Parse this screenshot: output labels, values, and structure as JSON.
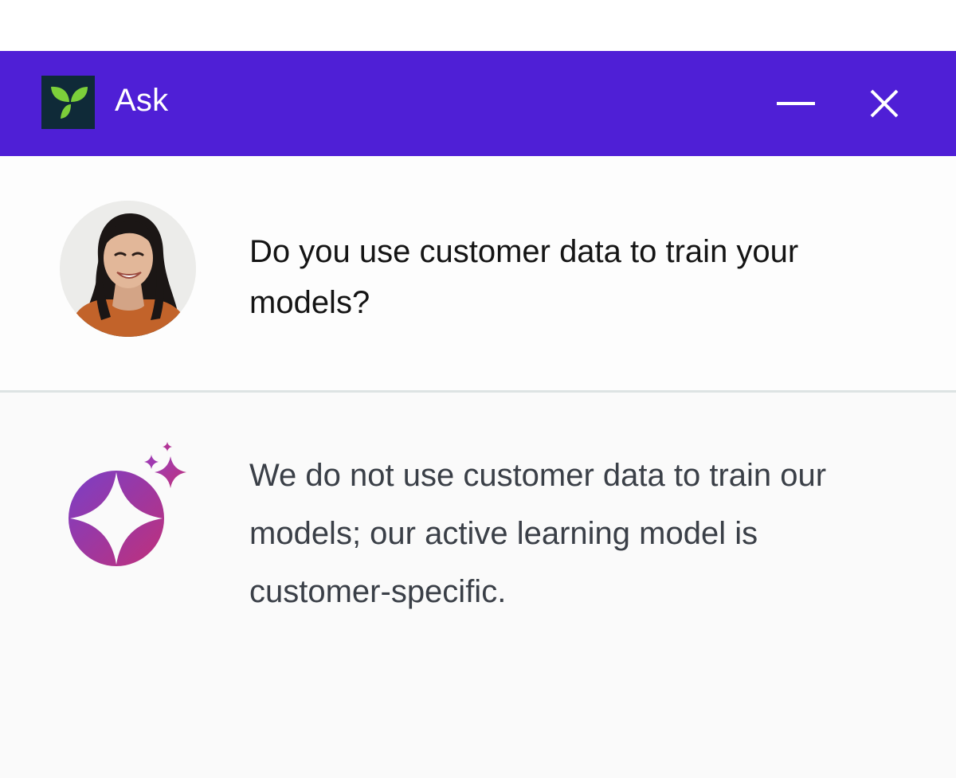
{
  "window": {
    "title": "Ask",
    "icons": {
      "logo": "leaf-logo-icon",
      "minimize": "minimize-icon",
      "close": "close-icon"
    }
  },
  "colors": {
    "header": "#4f1fd6",
    "logo_bg": "#0f2a38",
    "logo_leaf": "#7ccf3a",
    "ai_gradient_start": "#7a3fc7",
    "ai_gradient_end": "#c0307a"
  },
  "conversation": {
    "question": {
      "avatar": "user-avatar",
      "text": "Do you use customer data to train your models?"
    },
    "answer": {
      "avatar": "ai-sparkle-icon",
      "text": "We do not use customer data to train our models; our active learning model is customer-specific."
    }
  }
}
